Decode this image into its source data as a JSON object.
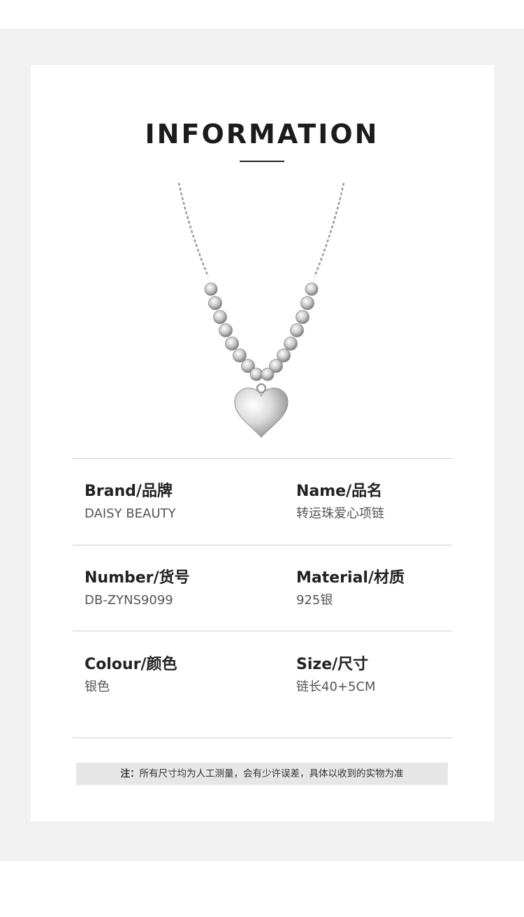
{
  "header": {
    "title": "INFORMATION"
  },
  "product": {
    "image_icon": "heart-pendant-necklace-icon"
  },
  "specs": {
    "brand": {
      "label": "Brand/品牌",
      "value": "DAISY BEAUTY"
    },
    "name": {
      "label": "Name/品名",
      "value": "转运珠爱心项链"
    },
    "number": {
      "label": "Number/货号",
      "value": "DB-ZYNS9099"
    },
    "material": {
      "label": "Material/材质",
      "value": "925银"
    },
    "colour": {
      "label": "Colour/颜色",
      "value": "银色"
    },
    "size": {
      "label": "Size/尺寸",
      "value": "链长40+5CM"
    }
  },
  "note": {
    "prefix": "注：",
    "text": "所有尺寸均为人工测量，会有少许误差，具体以收到的实物为准"
  },
  "colors": {
    "background_band": "#f1f1f1",
    "card": "#ffffff",
    "note_bg": "#e6e6e6"
  }
}
